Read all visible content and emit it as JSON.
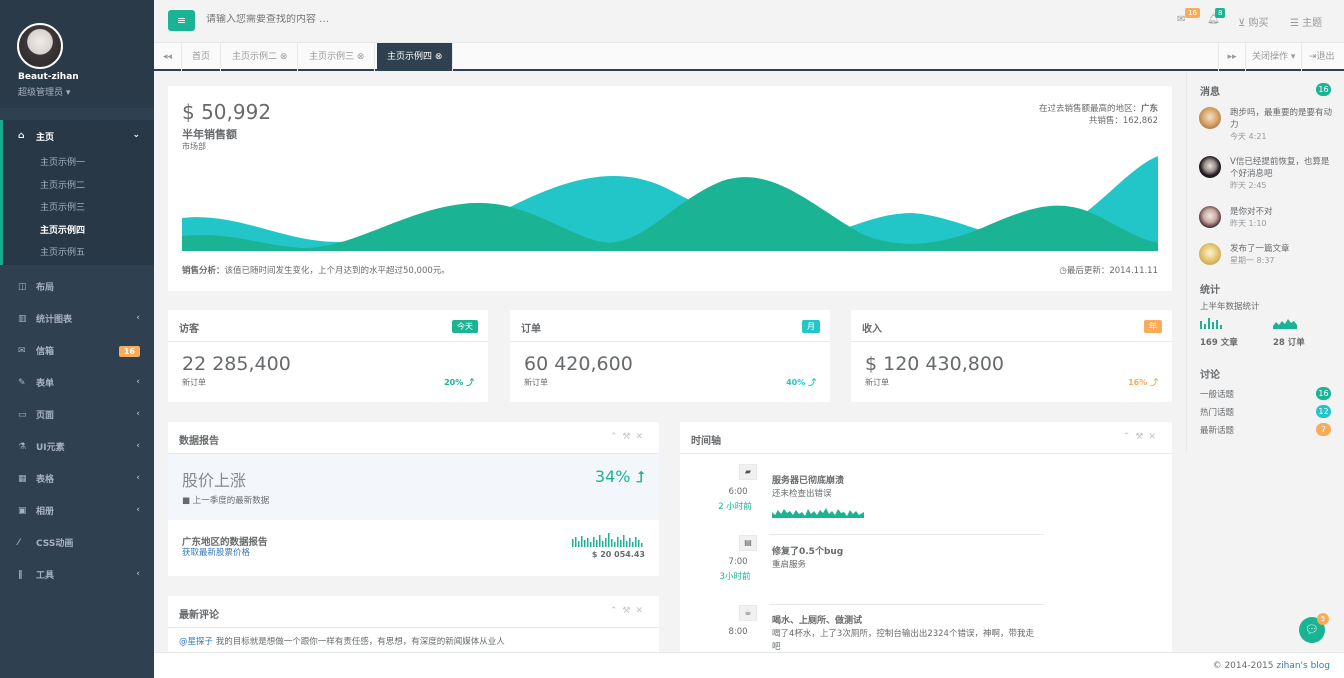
{
  "user": {
    "name": "Beaut-zihan",
    "role": "超级管理员 ▾"
  },
  "sidebar": {
    "items": [
      {
        "label": "主页",
        "icon": "home-icon"
      },
      {
        "label": "布局",
        "icon": "columns-icon"
      },
      {
        "label": "统计图表",
        "icon": "bar-chart-icon"
      },
      {
        "label": "信箱",
        "icon": "envelope-icon",
        "badge": "16"
      },
      {
        "label": "表单",
        "icon": "edit-icon"
      },
      {
        "label": "页面",
        "icon": "desktop-icon"
      },
      {
        "label": "UI元素",
        "icon": "flask-icon"
      },
      {
        "label": "表格",
        "icon": "table-icon"
      },
      {
        "label": "相册",
        "icon": "picture-icon"
      },
      {
        "label": "CSS动画",
        "icon": "magic-icon"
      },
      {
        "label": "工具",
        "icon": "cutlery-icon"
      }
    ],
    "sub": [
      "主页示例一",
      "主页示例二",
      "主页示例三",
      "主页示例四",
      "主页示例五"
    ]
  },
  "search": {
    "placeholder": "请输入您需要查找的内容 …"
  },
  "topright": {
    "mail_badge": "16",
    "bell_badge": "8",
    "buy": "购买",
    "theme": "主题"
  },
  "tabs": [
    "首页",
    "主页示例二 ⊗",
    "主页示例三 ⊗",
    "主页示例四 ⊗"
  ],
  "tab_actions": {
    "close_ops": "关闭操作 ▾",
    "exit": "退出"
  },
  "sales": {
    "amount": "$ 50,992",
    "title": "半年销售额",
    "dept": "市场部",
    "region_label": "在过去销售额最高的地区：",
    "region": "广东",
    "total_label": "共销售：",
    "total": "162,862",
    "analysis_label": "销售分析：",
    "analysis": "该值已随时间发生变化，上个月达到的水平超过50,000元。",
    "updated_label": "最后更新：",
    "updated": "2014.11.11"
  },
  "stats": [
    {
      "title": "访客",
      "badge": "今天",
      "value": "22 285,400",
      "sub": "新订单",
      "pct": "20% ⤴",
      "color": "#1ab394"
    },
    {
      "title": "订单",
      "badge": "月",
      "value": "60 420,600",
      "sub": "新订单",
      "pct": "40% ⤴",
      "color": "#23c6c8"
    },
    {
      "title": "收入",
      "badge": "年",
      "value": "$ 120 430,800",
      "sub": "新订单",
      "pct": "16% ⤴",
      "color": "#f8ac59"
    }
  ],
  "report": {
    "title": "数据报告",
    "stock": "股价上涨",
    "stock_pct": "34%",
    "stock_sub": "上一季度的最新数据",
    "region_title": "广东地区的数据报告",
    "region_link": "获取最新股票价格",
    "region_value": "$ 20 054.43"
  },
  "comments": {
    "title": "最新评论",
    "author": "@星探子",
    "text": "我的目标就是想做一个跟你一样有责任感，有思想，有深度的新闻媒体从业人"
  },
  "timeline": {
    "title": "时间轴",
    "items": [
      {
        "time": "6:00",
        "rel": "2 小时前",
        "title": "服务器已彻底崩溃",
        "body": "还未检查出错误"
      },
      {
        "time": "7:00",
        "rel": "3小时前",
        "title": "修复了0.5个bug",
        "body": "重启服务"
      },
      {
        "time": "8:00",
        "rel": "",
        "title": "喝水、上厕所、做测试",
        "body": "喝了4杯水，上了3次厕所，控制台输出出2324个错误，神啊，带我走吧"
      }
    ]
  },
  "right": {
    "msg_title": "消息",
    "msg_badge": "16",
    "messages": [
      {
        "text": "跑步吗，最重要的是要有动力",
        "time": "今天 4:21"
      },
      {
        "text": "Ⅴ信已经提前恢复，也算是个好消息吧",
        "time": "昨天 2:45"
      },
      {
        "text": "是你对不对",
        "time": "昨天 1:10"
      },
      {
        "text": "发布了一篇文章",
        "time": "星期一 8:37"
      }
    ],
    "stats_title": "统计",
    "stats_sub": "上半年数据统计",
    "articles": "169 文章",
    "orders": "28 订单",
    "disc_title": "讨论",
    "discussions": [
      {
        "label": "一般话题",
        "count": "16",
        "color": "#1ab394"
      },
      {
        "label": "热门话题",
        "count": "12",
        "color": "#23c6c8"
      },
      {
        "label": "最新话题",
        "count": "7",
        "color": "#f8ac59"
      }
    ]
  },
  "footer": {
    "text": "© 2014-2015",
    "link": "zihan's blog"
  },
  "chat_badge": "5"
}
